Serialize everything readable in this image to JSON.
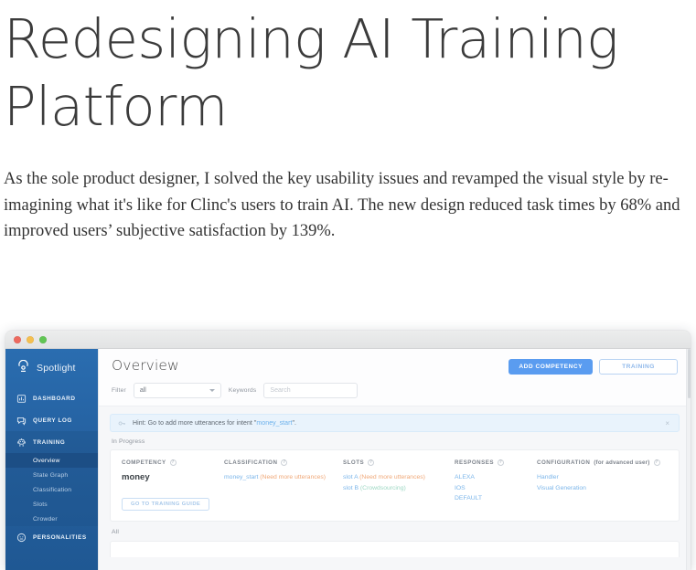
{
  "article": {
    "title": "Redesigning AI Training Platform",
    "intro": "As the sole product designer, I solved the key usability issues and revamped the visual style by re-imagining what it's like for Clinc's users to train AI. The new design reduced task times by 68% and improved users’ subjective satisfaction by 139%."
  },
  "app": {
    "brand": {
      "name": "Spotlight",
      "logo_icon": "spotlight-ring-icon"
    },
    "sidebar": {
      "items": [
        {
          "label": "DASHBOARD",
          "icon": "chart-bars-icon",
          "active": false
        },
        {
          "label": "QUERY LOG",
          "icon": "comment-lines-icon",
          "active": false
        },
        {
          "label": "TRAINING",
          "icon": "robot-icon",
          "active": true
        },
        {
          "label": "PERSONALITIES",
          "icon": "face-circle-icon",
          "active": false
        }
      ],
      "training_subitems": [
        {
          "label": "Overview",
          "active": true
        },
        {
          "label": "State Graph",
          "active": false
        },
        {
          "label": "Classification",
          "active": false
        },
        {
          "label": "Slots",
          "active": false
        },
        {
          "label": "Crowder",
          "active": false
        }
      ]
    },
    "header": {
      "title": "Overview",
      "add_competency_label": "ADD COMPETENCY",
      "training_label": "TRAINING"
    },
    "filters": {
      "filter_label": "Filter",
      "filter_value": "all",
      "keywords_label": "Keywords",
      "search_placeholder": "Search"
    },
    "hint": {
      "icon": "key-icon",
      "text_before": "Hint: Go to add more utterances for intent \"",
      "link": "money_start",
      "text_after": "\".",
      "close_label": "×"
    },
    "sections": {
      "in_progress_label": "In Progress",
      "all_label": "All"
    },
    "card": {
      "columns": [
        {
          "heading": "COMPETENCY",
          "heading_suffix": "",
          "help": "?"
        },
        {
          "heading": "CLASSIFICATION",
          "heading_suffix": "",
          "help": "?"
        },
        {
          "heading": "SLOTS",
          "heading_suffix": "",
          "help": "?"
        },
        {
          "heading": "RESPONSES",
          "heading_suffix": "",
          "help": "?"
        },
        {
          "heading": "CONFIGURATION",
          "heading_suffix": "(for advanced user)",
          "help": "?"
        }
      ],
      "competency_name": "money",
      "training_guide_label": "GO TO TRAINING GUIDE",
      "classification": [
        {
          "link": "money_start",
          "note": "(Need more utterances)",
          "note_type": "warn"
        }
      ],
      "slots": [
        {
          "link": "slot A",
          "note": "(Need more utterances)",
          "note_type": "warn"
        },
        {
          "link": "slot B",
          "note": "(Crowdsourcing)",
          "note_type": "ok"
        }
      ],
      "responses": [
        {
          "link": "ALEXA"
        },
        {
          "link": "IOS"
        },
        {
          "link": "DEFAULT"
        }
      ],
      "configuration": [
        {
          "link": "Handler"
        },
        {
          "link": "Visual Generation"
        }
      ]
    },
    "colors": {
      "sidebar_blue": "#245f9e",
      "sidebar_active": "#1c4e85",
      "primary_button": "#5a9cf0",
      "link_blue": "#7cb6ea",
      "warn_orange": "#f0a878",
      "ok_green": "#9fd8c4"
    },
    "window_controls": {
      "close": "close-traffic-light",
      "minimize": "minimize-traffic-light",
      "zoom": "zoom-traffic-light"
    }
  }
}
